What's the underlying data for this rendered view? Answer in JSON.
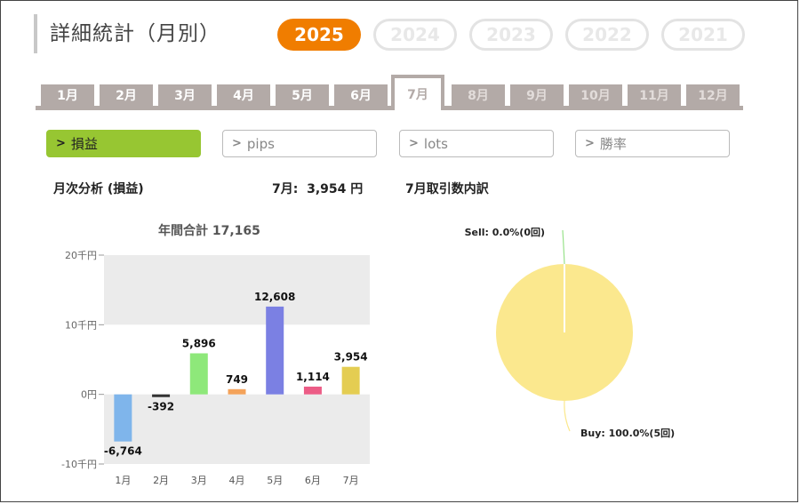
{
  "page_title": "詳細統計（月別）",
  "years": [
    {
      "label": "2025",
      "active": true
    },
    {
      "label": "2024",
      "active": false
    },
    {
      "label": "2023",
      "active": false
    },
    {
      "label": "2022",
      "active": false
    },
    {
      "label": "2021",
      "active": false
    }
  ],
  "months": [
    {
      "label": "1月",
      "state": "past"
    },
    {
      "label": "2月",
      "state": "past"
    },
    {
      "label": "3月",
      "state": "past"
    },
    {
      "label": "4月",
      "state": "past"
    },
    {
      "label": "5月",
      "state": "past"
    },
    {
      "label": "6月",
      "state": "past"
    },
    {
      "label": "7月",
      "state": "active"
    },
    {
      "label": "8月",
      "state": "future"
    },
    {
      "label": "9月",
      "state": "future"
    },
    {
      "label": "10月",
      "state": "future"
    },
    {
      "label": "11月",
      "state": "future"
    },
    {
      "label": "12月",
      "state": "future"
    }
  ],
  "metrics": [
    {
      "label": "損益",
      "active": true
    },
    {
      "label": "pips",
      "active": false
    },
    {
      "label": "lots",
      "active": false
    },
    {
      "label": "勝率",
      "active": false
    }
  ],
  "monthly_section": {
    "title": "月次分析 (損益)",
    "month_total": "7月:  3,954 円"
  },
  "trade_section": {
    "title": "7月取引数内訳"
  },
  "colors": {
    "accent_year": "#f07d00",
    "accent_metric": "#97c632",
    "tab_gray": "#b3aaa7"
  },
  "chart_data": [
    {
      "type": "bar",
      "title": "年間合計 17,165",
      "categories": [
        "1月",
        "2月",
        "3月",
        "4月",
        "5月",
        "6月",
        "7月"
      ],
      "values": [
        -6764,
        -392,
        5896,
        749,
        12608,
        1114,
        3954
      ],
      "value_labels": [
        "-6,764",
        "-392",
        "5,896",
        "749",
        "12,608",
        "1,114",
        "3,954"
      ],
      "bar_colors": [
        "#7fb5eb",
        "#333333",
        "#8ee87a",
        "#f4a35a",
        "#7b80e3",
        "#ec5c86",
        "#e4cd52"
      ],
      "yticks": [
        {
          "value": 20000,
          "label": "20千円"
        },
        {
          "value": 10000,
          "label": "10千円"
        },
        {
          "value": 0,
          "label": "0円"
        },
        {
          "value": -10000,
          "label": "-10千円"
        }
      ],
      "ylim": [
        -10000,
        20000
      ],
      "grid": "alternating bands"
    },
    {
      "type": "pie",
      "slices": [
        {
          "name": "Buy",
          "value": 100.0,
          "label": "Buy: 100.0%(5回)",
          "color": "#fbe88e"
        },
        {
          "name": "Sell",
          "value": 0.0,
          "label": "Sell: 0.0%(0回)",
          "color": "#98e28a"
        }
      ]
    }
  ]
}
